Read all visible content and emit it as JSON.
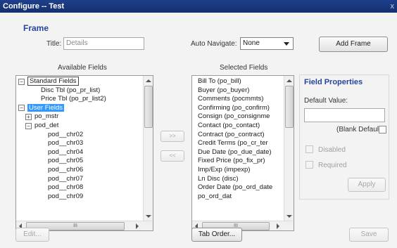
{
  "window": {
    "title": "Configure -- Test",
    "close_glyph": "x"
  },
  "frame": {
    "section_title": "Frame",
    "title_label": "Title:",
    "title_value": "Details",
    "auto_navigate_label": "Auto Navigate:",
    "auto_navigate_value": "None",
    "add_frame_label": "Add Frame"
  },
  "available": {
    "header": "Available Fields",
    "items": [
      {
        "label": "Standard Fields",
        "indent": 0,
        "expander": "−",
        "style": "focused"
      },
      {
        "label": "Disc Tbl (po_pr_list)",
        "indent": 2,
        "expander": "",
        "style": ""
      },
      {
        "label": "Price Tbl (po_pr_list2)",
        "indent": 2,
        "expander": "",
        "style": ""
      },
      {
        "label": "User Fields",
        "indent": 0,
        "expander": "−",
        "style": "selected"
      },
      {
        "label": "po_mstr",
        "indent": 1,
        "expander": "+",
        "style": ""
      },
      {
        "label": "pod_det",
        "indent": 1,
        "expander": "−",
        "style": ""
      },
      {
        "label": "pod__chr02",
        "indent": 3,
        "expander": "",
        "style": ""
      },
      {
        "label": "pod__chr03",
        "indent": 3,
        "expander": "",
        "style": ""
      },
      {
        "label": "pod__chr04",
        "indent": 3,
        "expander": "",
        "style": ""
      },
      {
        "label": "pod__chr05",
        "indent": 3,
        "expander": "",
        "style": ""
      },
      {
        "label": "pod__chr06",
        "indent": 3,
        "expander": "",
        "style": ""
      },
      {
        "label": "pod__chr07",
        "indent": 3,
        "expander": "",
        "style": ""
      },
      {
        "label": "pod__chr08",
        "indent": 3,
        "expander": "",
        "style": ""
      },
      {
        "label": "pod__chr09",
        "indent": 3,
        "expander": "",
        "style": ""
      }
    ],
    "scroll_thumb_glyph": "III"
  },
  "move": {
    "add_label": ">>",
    "remove_label": "<<"
  },
  "selected": {
    "header": "Selected Fields",
    "items": [
      "Bill To (po_bill)",
      "Buyer (po_buyer)",
      "Comments (pocmmts)",
      "Confirming (po_confirm)",
      "Consign (po_consignme",
      "Contact (po_contact)",
      "Contract (po_contract)",
      "Credit Terms (po_cr_ter",
      "Due Date (po_due_date)",
      "Fixed Price (po_fix_pr)",
      "Imp/Exp (impexp)",
      "Ln Disc (disc)",
      "Order Date (po_ord_date",
      "po_ord_dat"
    ],
    "scroll_thumb_glyph": "III"
  },
  "properties": {
    "title": "Field Properties",
    "default_value_label": "Default Value:",
    "default_value": "",
    "blank_default_label": "(Blank Default)",
    "disabled_label": "Disabled",
    "required_label": "Required",
    "apply_label": "Apply"
  },
  "footer": {
    "edit_label": "Edit...",
    "tab_order_label": "Tab Order...",
    "save_label": "Save"
  },
  "colors": {
    "accent": "#26459a",
    "selection": "#3399ff",
    "titlebar": "#1f3f8c"
  }
}
